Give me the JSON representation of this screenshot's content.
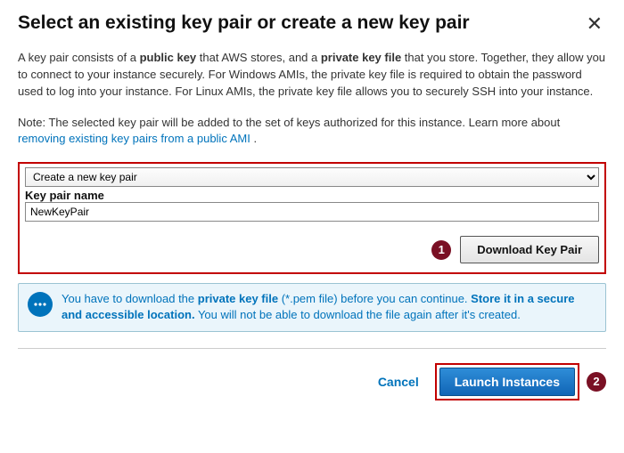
{
  "header": {
    "title": "Select an existing key pair or create a new key pair",
    "close": "✕"
  },
  "body": {
    "para1_a": "A key pair consists of a ",
    "para1_b": "public key",
    "para1_c": " that AWS stores, and a ",
    "para1_d": "private key file",
    "para1_e": " that you store. Together, they allow you to connect to your instance securely. For Windows AMIs, the private key file is required to obtain the password used to log into your instance. For Linux AMIs, the private key file allows you to securely SSH into your instance.",
    "para2_a": "Note: The selected key pair will be added to the set of keys authorized for this instance. Learn more about ",
    "para2_link": "removing existing key pairs from a public AMI",
    "para2_end": " ."
  },
  "form": {
    "select_value": "Create a new key pair",
    "kp_label": "Key pair name",
    "kp_value": "NewKeyPair",
    "download_label": "Download Key Pair"
  },
  "annotations": {
    "step1": "1",
    "step2": "2"
  },
  "info": {
    "a": "You have to download the ",
    "b": "private key file",
    "c": " (*.pem file) before you can continue. ",
    "d": "Store it in a secure and accessible location.",
    "e": " You will not be able to download the file again after it's created."
  },
  "footer": {
    "cancel": "Cancel",
    "launch": "Launch Instances"
  }
}
